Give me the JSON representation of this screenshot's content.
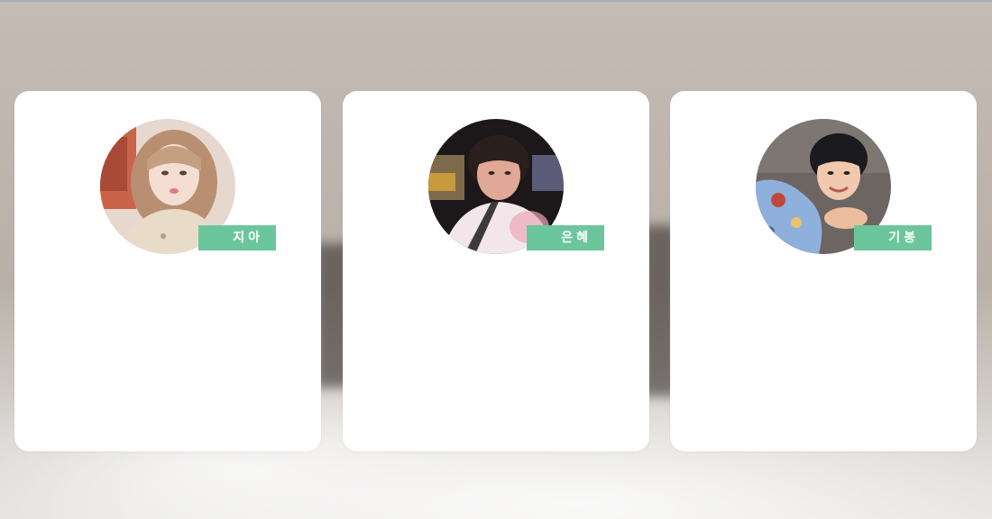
{
  "profiles": [
    {
      "name": "지아",
      "avatar": "woman-selfie-photo"
    },
    {
      "name": "은혜",
      "avatar": "woman-in-car-photo"
    },
    {
      "name": "기봉",
      "avatar": "man-smiling-photo"
    }
  ],
  "colors": {
    "badge": "#6cc69b",
    "card": "#ffffff",
    "background": "#beb6ae"
  }
}
